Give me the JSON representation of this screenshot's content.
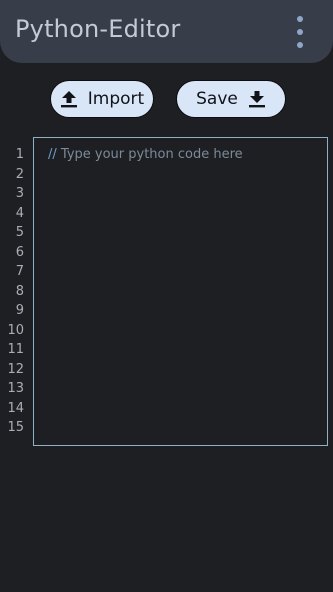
{
  "app": {
    "title": "Python-Editor",
    "menu_icon": "more-vertical-icon"
  },
  "toolbar": {
    "import_label": "Import",
    "import_icon": "upload-icon",
    "save_label": "Save",
    "save_icon": "download-icon"
  },
  "editor": {
    "placeholder_slashes": "//",
    "placeholder_text": "Type your python code here",
    "line_numbers": [
      "1",
      "2",
      "3",
      "4",
      "5",
      "6",
      "7",
      "8",
      "9",
      "10",
      "11",
      "12",
      "13",
      "14",
      "15"
    ]
  },
  "colors": {
    "background": "#1e1f23",
    "appbar": "#383d4a",
    "button": "#d9e6f8",
    "editor_border": "#8fb0c6"
  }
}
